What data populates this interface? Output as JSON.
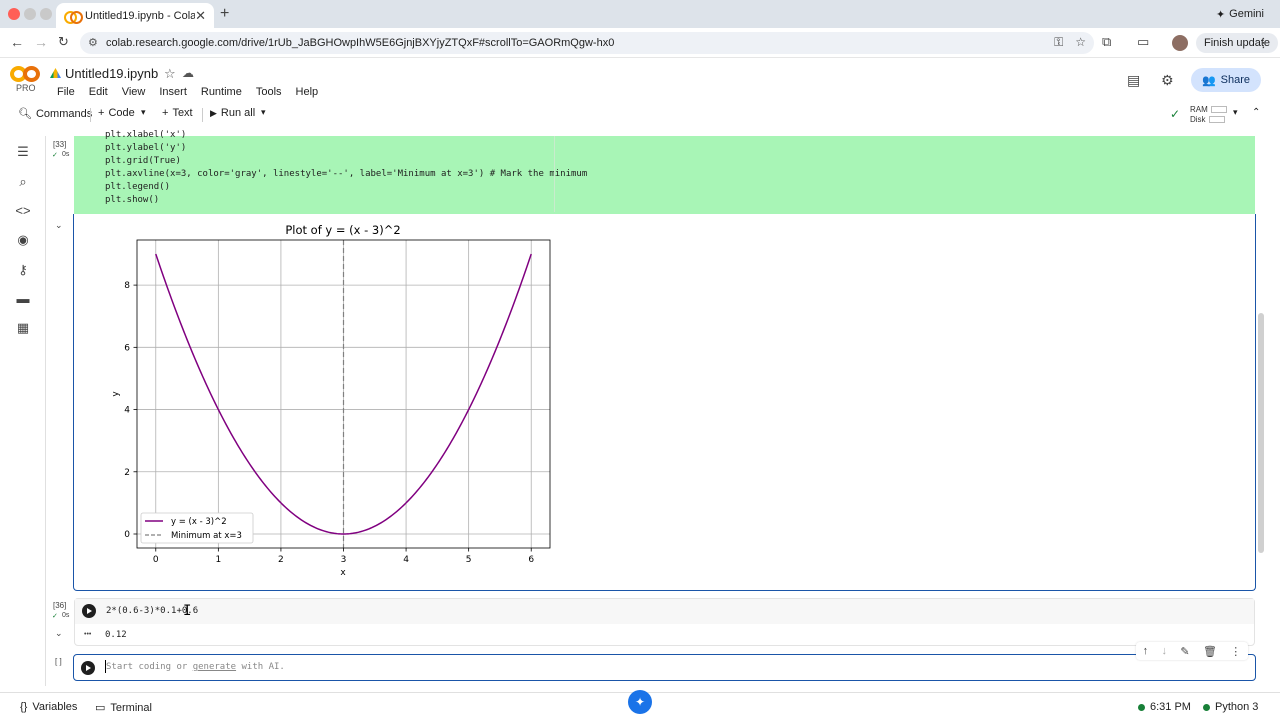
{
  "browser": {
    "tab_title": "Untitled19.ipynb - Colab",
    "tab_close": "✕",
    "new_tab": "+",
    "gemini_label": "Gemini",
    "url": "colab.research.google.com/drive/1rUb_JaBGHOwpIhW5E6GjnjBXYjyZTQxF#scrollTo=GAORmQgw-hx0",
    "finish_update": "Finish update"
  },
  "colab": {
    "pro_label": "PRO",
    "notebook_title": "Untitled19.ipynb",
    "menu": [
      "File",
      "Edit",
      "View",
      "Insert",
      "Runtime",
      "Tools",
      "Help"
    ],
    "share_label": "Share",
    "toolbar": {
      "commands": "Commands",
      "code": "Code",
      "text": "Text",
      "run_all": "Run all"
    },
    "ram_label": "RAM",
    "disk_label": "Disk"
  },
  "cell33": {
    "exec_count": "[33]",
    "time": "0s",
    "code_lines": [
      "plt.xlabel('x')",
      "plt.ylabel('y')",
      "plt.grid(True)",
      "plt.axvline(x=3, color='gray', linestyle='--', label='Minimum at x=3') # Mark the minimum",
      "plt.legend()",
      "plt.show()"
    ]
  },
  "chart_data": {
    "type": "line",
    "title": "Plot of y = (x - 3)^2",
    "xlabel": "x",
    "ylabel": "y",
    "xlim": [
      -0.3,
      6.3
    ],
    "ylim": [
      -0.45,
      9.45
    ],
    "xticks": [
      0,
      1,
      2,
      3,
      4,
      5,
      6
    ],
    "yticks": [
      0,
      2,
      4,
      6,
      8
    ],
    "grid": true,
    "legend_position": "lower left",
    "series": [
      {
        "name": "y = (x - 3)^2",
        "color": "#800080",
        "style": "solid",
        "x": [
          0,
          0.25,
          0.5,
          0.75,
          1,
          1.25,
          1.5,
          1.75,
          2,
          2.25,
          2.5,
          2.75,
          3,
          3.25,
          3.5,
          3.75,
          4,
          4.25,
          4.5,
          4.75,
          5,
          5.25,
          5.5,
          5.75,
          6
        ],
        "y": [
          9,
          7.5625,
          6.25,
          5.0625,
          4,
          3.0625,
          2.25,
          1.5625,
          1,
          0.5625,
          0.25,
          0.0625,
          0,
          0.0625,
          0.25,
          0.5625,
          1,
          1.5625,
          2.25,
          3.0625,
          4,
          5.0625,
          6.25,
          7.5625,
          9
        ]
      },
      {
        "name": "Minimum at x=3",
        "color": "#808080",
        "style": "dashed",
        "vline_x": 3
      }
    ]
  },
  "cell36": {
    "exec_count": "[36]",
    "time": "0s",
    "code": "2*(0.6-3)*0.1+0.6",
    "output_prefix": "•••",
    "output": "0.12"
  },
  "new_cell": {
    "exec_count": "[ ]",
    "placeholder_start": "Start coding or ",
    "placeholder_link": "generate",
    "placeholder_end": " with AI."
  },
  "statusbar": {
    "variables": "Variables",
    "terminal": "Terminal",
    "time": "6:31 PM",
    "runtime": "Python 3"
  }
}
